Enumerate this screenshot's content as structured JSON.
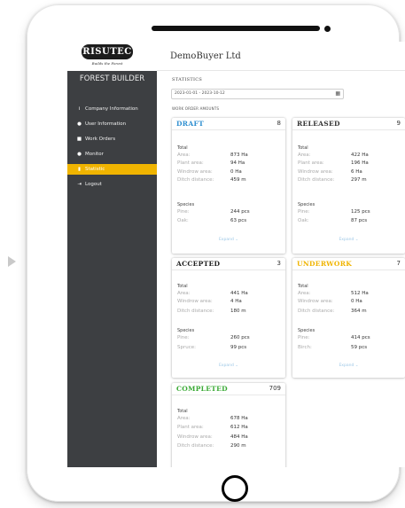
{
  "brand": {
    "logo_text": "RISUTEC",
    "tagline": "Builds the Forest",
    "app_title": "FOREST BUILDER"
  },
  "sidebar": {
    "items": [
      {
        "icon": "info-icon",
        "glyph": "i",
        "label": "Company Information"
      },
      {
        "icon": "user-icon",
        "glyph": "●",
        "label": "User Information"
      },
      {
        "icon": "clipboard-icon",
        "glyph": "■",
        "label": "Work Orders"
      },
      {
        "icon": "monitor-icon",
        "glyph": "●",
        "label": "Monitor"
      },
      {
        "icon": "chart-icon",
        "glyph": "▮",
        "label": "Statistic",
        "active": true
      },
      {
        "icon": "logout-icon",
        "glyph": "⇥",
        "label": "Logout"
      }
    ]
  },
  "header": {
    "company": "DemoBuyer Ltd"
  },
  "statistics": {
    "title": "STATISTICS",
    "date_range": "2023-01-01 - 2023-10-12",
    "section_title": "WORK ORDER AMOUNTS"
  },
  "labels": {
    "total": "Total",
    "species": "Species",
    "expand": "Expand"
  },
  "colors": {
    "draft": "#2f8fd0",
    "released": "#333333",
    "accepted": "#222222",
    "underwork": "#f0b400",
    "completed": "#3aaa35",
    "sidebar_bg": "#3d3f42",
    "active_nav": "#f0b400"
  },
  "cards": {
    "draft": {
      "name": "DRAFT",
      "count": "8",
      "rows": [
        {
          "label": "Area:",
          "value": "873 Ha"
        },
        {
          "label": "Plant area:",
          "value": "94 Ha"
        },
        {
          "label": "Windrow area:",
          "value": "0 Ha"
        },
        {
          "label": "Ditch distance:",
          "value": "459 m"
        }
      ],
      "species": [
        {
          "label": "Pine:",
          "value": "244 pcs"
        },
        {
          "label": "Oak:",
          "value": "63 pcs"
        }
      ]
    },
    "released": {
      "name": "RELEASED",
      "count": "9",
      "rows": [
        {
          "label": "Area:",
          "value": "422 Ha"
        },
        {
          "label": "Plant area:",
          "value": "196 Ha"
        },
        {
          "label": "Windrow area:",
          "value": "6 Ha"
        },
        {
          "label": "Ditch distance:",
          "value": "297 m"
        }
      ],
      "species": [
        {
          "label": "Pine:",
          "value": "125 pcs"
        },
        {
          "label": "Oak:",
          "value": "87 pcs"
        }
      ]
    },
    "accepted": {
      "name": "ACCEPTED",
      "count": "3",
      "rows": [
        {
          "label": "Area:",
          "value": "441 Ha"
        },
        {
          "label": "Windrow area:",
          "value": "4 Ha"
        },
        {
          "label": "Ditch distance:",
          "value": "180 m"
        }
      ],
      "species": [
        {
          "label": "Pine:",
          "value": "260 pcs"
        },
        {
          "label": "Spruce:",
          "value": "99 pcs"
        }
      ]
    },
    "underwork": {
      "name": "UNDERWORK",
      "count": "7",
      "rows": [
        {
          "label": "Area:",
          "value": "512 Ha"
        },
        {
          "label": "Windrow area:",
          "value": "0 Ha"
        },
        {
          "label": "Ditch distance:",
          "value": "364 m"
        }
      ],
      "species": [
        {
          "label": "Pine:",
          "value": "414 pcs"
        },
        {
          "label": "Birch:",
          "value": "59 pcs"
        }
      ]
    },
    "completed": {
      "name": "COMPLETED",
      "count": "709",
      "rows": [
        {
          "label": "Area:",
          "value": "678 Ha"
        },
        {
          "label": "Plant area:",
          "value": "612 Ha"
        },
        {
          "label": "Windrow area:",
          "value": "484 Ha"
        },
        {
          "label": "Ditch distance:",
          "value": "290 m"
        }
      ]
    }
  }
}
